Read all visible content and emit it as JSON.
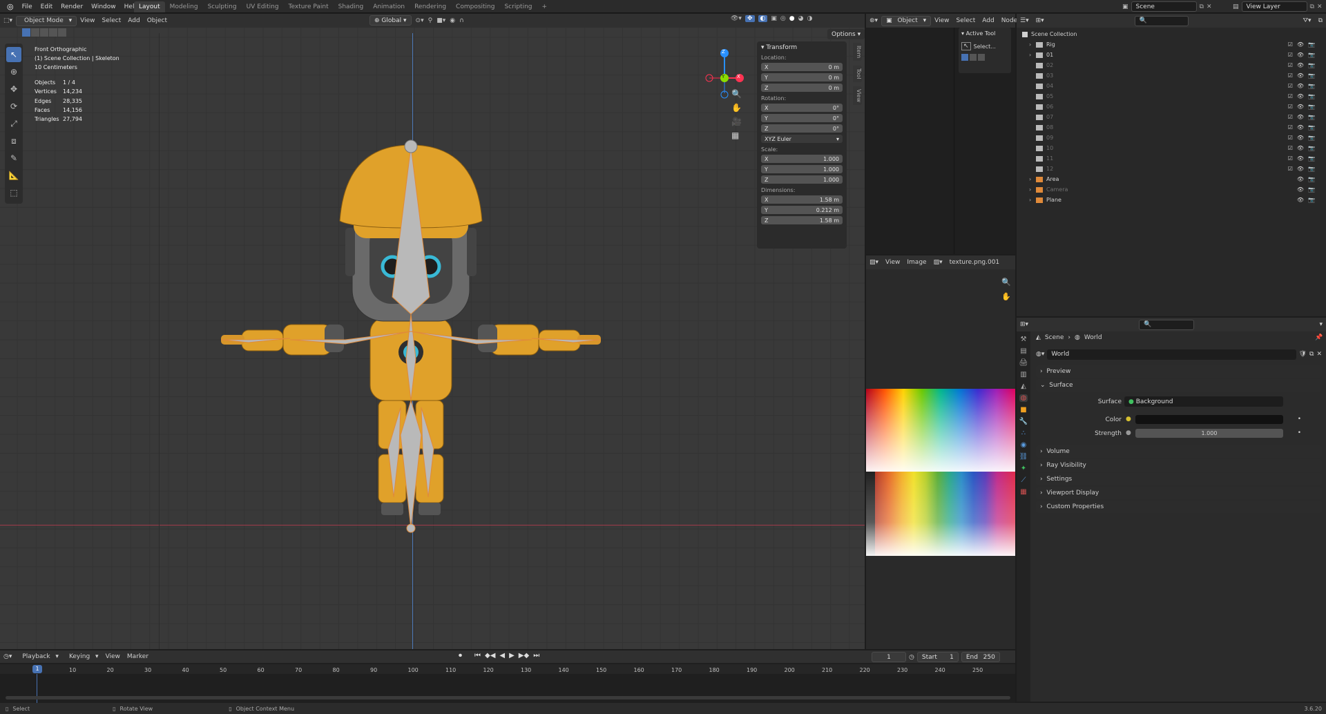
{
  "menu": [
    "File",
    "Edit",
    "Render",
    "Window",
    "Help"
  ],
  "workspaces": [
    "Layout",
    "Modeling",
    "Sculpting",
    "UV Editing",
    "Texture Paint",
    "Shading",
    "Animation",
    "Rendering",
    "Compositing",
    "Scripting"
  ],
  "active_workspace": "Layout",
  "scene_name": "Scene",
  "view_layer": "View Layer",
  "viewport": {
    "mode": "Object Mode",
    "menus": [
      "View",
      "Select",
      "Add",
      "Object"
    ],
    "transform_orientation": "Global",
    "options_label": "Options",
    "view_name": "Front Orthographic",
    "collection_path": "(1) Scene Collection | Skeleton",
    "scale_text": "10 Centimeters",
    "stats": [
      {
        "label": "Objects",
        "value": "1 / 4"
      },
      {
        "label": "Vertices",
        "value": "14,234"
      },
      {
        "label": "Edges",
        "value": "28,335"
      },
      {
        "label": "Faces",
        "value": "14,156"
      },
      {
        "label": "Triangles",
        "value": "27,794"
      }
    ],
    "gizmo_axes": [
      "Z",
      "Y",
      "X"
    ]
  },
  "npanel": {
    "section": "Transform",
    "location_label": "Location:",
    "location": [
      {
        "axis": "X",
        "value": "0 m"
      },
      {
        "axis": "Y",
        "value": "0 m"
      },
      {
        "axis": "Z",
        "value": "0 m"
      }
    ],
    "rotation_label": "Rotation:",
    "rotation": [
      {
        "axis": "X",
        "value": "0°"
      },
      {
        "axis": "Y",
        "value": "0°"
      },
      {
        "axis": "Z",
        "value": "0°"
      }
    ],
    "rotation_mode": "XYZ Euler",
    "scale_label": "Scale:",
    "scale": [
      {
        "axis": "X",
        "value": "1.000"
      },
      {
        "axis": "Y",
        "value": "1.000"
      },
      {
        "axis": "Z",
        "value": "1.000"
      }
    ],
    "dimensions_label": "Dimensions:",
    "dimensions": [
      {
        "axis": "X",
        "value": "1.58 m"
      },
      {
        "axis": "Y",
        "value": "0.212 m"
      },
      {
        "axis": "Z",
        "value": "1.58 m"
      }
    ],
    "tabs": [
      "Item",
      "Tool",
      "View"
    ]
  },
  "node_editor": {
    "mode": "Object",
    "menus": [
      "View",
      "Select",
      "Add",
      "Node"
    ],
    "active_tool_title": "Active Tool",
    "active_tool_name": "Select..."
  },
  "image_editor": {
    "menus": [
      "View",
      "Image"
    ],
    "image_name": "texture.png.001"
  },
  "outliner": {
    "root": "Scene Collection",
    "items": [
      {
        "name": "Rig",
        "dim": false
      },
      {
        "name": "01",
        "dim": false
      },
      {
        "name": "02",
        "dim": true
      },
      {
        "name": "03",
        "dim": true
      },
      {
        "name": "04",
        "dim": true
      },
      {
        "name": "05",
        "dim": true
      },
      {
        "name": "06",
        "dim": true
      },
      {
        "name": "07",
        "dim": true
      },
      {
        "name": "08",
        "dim": true
      },
      {
        "name": "09",
        "dim": true
      },
      {
        "name": "10",
        "dim": true
      },
      {
        "name": "11",
        "dim": true
      },
      {
        "name": "12",
        "dim": true
      },
      {
        "name": "Area",
        "dim": false
      },
      {
        "name": "Camera",
        "dim": true
      },
      {
        "name": "Plane",
        "dim": false
      }
    ]
  },
  "properties": {
    "breadcrumb": [
      "Scene",
      "World"
    ],
    "datablock": "World",
    "panels": [
      "Preview",
      "Surface",
      "Volume",
      "Ray Visibility",
      "Settings",
      "Viewport Display",
      "Custom Properties"
    ],
    "surface_label": "Surface",
    "surface_value": "Background",
    "color_label": "Color",
    "strength_label": "Strength",
    "strength_value": "1.000"
  },
  "timeline": {
    "menus": [
      "Playback",
      "Keying",
      "View",
      "Marker"
    ],
    "current_frame": "1",
    "start_label": "Start",
    "start_value": "1",
    "end_label": "End",
    "end_value": "250",
    "ticks": [
      "10",
      "20",
      "30",
      "40",
      "50",
      "60",
      "70",
      "80",
      "90",
      "100",
      "110",
      "120",
      "130",
      "140",
      "150",
      "160",
      "170",
      "180",
      "190",
      "200",
      "210",
      "220",
      "230",
      "240",
      "250"
    ]
  },
  "statusbar": {
    "hints": [
      "Select",
      "Rotate View",
      "Object Context Menu"
    ],
    "version": "3.6.20"
  },
  "colors": {
    "accent": "#4772b3",
    "robot_orange": "#e0a12a",
    "bone": "#b9b9b9",
    "x_axis": "#ff3352",
    "y_axis": "#8bdc00",
    "z_axis": "#2890ff"
  }
}
